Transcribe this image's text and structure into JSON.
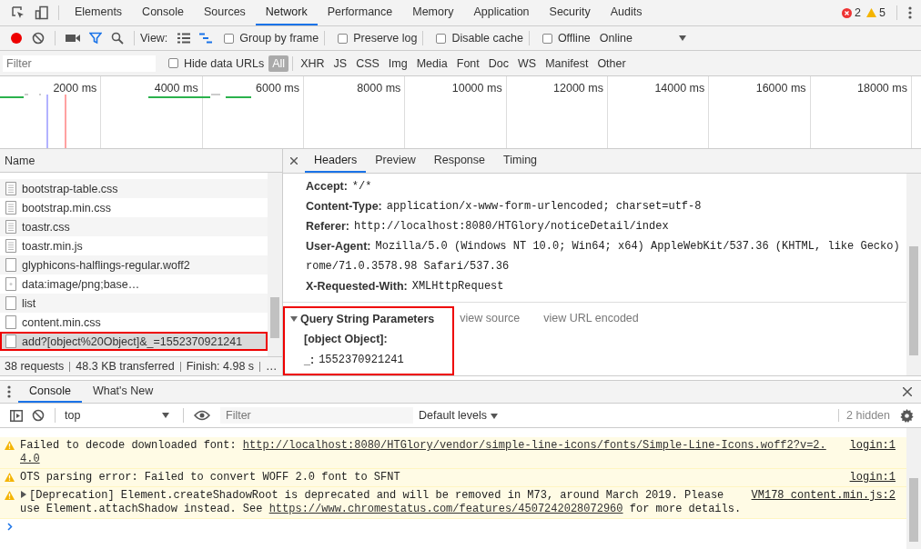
{
  "main_tabs": [
    {
      "label": "Elements",
      "selected": false
    },
    {
      "label": "Console",
      "selected": false
    },
    {
      "label": "Sources",
      "selected": false
    },
    {
      "label": "Network",
      "selected": true
    },
    {
      "label": "Performance",
      "selected": false
    },
    {
      "label": "Memory",
      "selected": false
    },
    {
      "label": "Application",
      "selected": false
    },
    {
      "label": "Security",
      "selected": false
    },
    {
      "label": "Audits",
      "selected": false
    }
  ],
  "issues": {
    "errors": "2",
    "warnings": "5"
  },
  "network_toolbar": {
    "recording": true,
    "view_label": "View:",
    "checkboxes": [
      {
        "label": "Group by frame",
        "checked": false
      },
      {
        "label": "Preserve log",
        "checked": false
      },
      {
        "label": "Disable cache",
        "checked": false
      },
      {
        "label": "Offline",
        "checked": false
      }
    ],
    "throttling": "Online"
  },
  "filter_bar": {
    "placeholder": "Filter",
    "hide_data_urls": {
      "label": "Hide data URLs",
      "checked": false
    },
    "types": [
      {
        "label": "All",
        "selected": true
      },
      {
        "label": "XHR",
        "selected": false
      },
      {
        "label": "JS",
        "selected": false
      },
      {
        "label": "CSS",
        "selected": false
      },
      {
        "label": "Img",
        "selected": false
      },
      {
        "label": "Media",
        "selected": false
      },
      {
        "label": "Font",
        "selected": false
      },
      {
        "label": "Doc",
        "selected": false
      },
      {
        "label": "WS",
        "selected": false
      },
      {
        "label": "Manifest",
        "selected": false
      },
      {
        "label": "Other",
        "selected": false
      }
    ]
  },
  "overview": {
    "ticks": [
      "2000 ms",
      "4000 ms",
      "6000 ms",
      "8000 ms",
      "10000 ms",
      "12000 ms",
      "14000 ms",
      "16000 ms",
      "18000 ms"
    ]
  },
  "requests": {
    "column": "Name",
    "rows": [
      {
        "name": "bootstrap-table.css",
        "kind": "stylesheet",
        "selected": false,
        "annotated": false
      },
      {
        "name": "bootstrap.min.css",
        "kind": "stylesheet",
        "selected": false,
        "annotated": false
      },
      {
        "name": "toastr.css",
        "kind": "stylesheet",
        "selected": false,
        "annotated": false
      },
      {
        "name": "toastr.min.js",
        "kind": "stylesheet",
        "selected": false,
        "annotated": false
      },
      {
        "name": "glyphicons-halflings-regular.woff2",
        "kind": "plain",
        "selected": false,
        "annotated": false
      },
      {
        "name": "data:image/png;base…",
        "kind": "image",
        "selected": false,
        "annotated": false
      },
      {
        "name": "list",
        "kind": "plain",
        "selected": false,
        "annotated": false
      },
      {
        "name": "content.min.css",
        "kind": "plain",
        "selected": false,
        "annotated": false
      },
      {
        "name": "add?[object%20Object]&_=1552370921241",
        "kind": "plain",
        "selected": true,
        "annotated": true
      }
    ],
    "summary": [
      "38 requests",
      "48.3 KB transferred",
      "Finish: 4.98 s",
      "…"
    ]
  },
  "details": {
    "tabs": [
      {
        "label": "Headers",
        "selected": true
      },
      {
        "label": "Preview",
        "selected": false
      },
      {
        "label": "Response",
        "selected": false
      },
      {
        "label": "Timing",
        "selected": false
      }
    ],
    "headers": [
      {
        "name": "Accept:",
        "value_lines": [
          "*/*"
        ]
      },
      {
        "name": "Content-Type:",
        "value_lines": [
          "application/x-www-form-urlencoded; charset=utf-8"
        ]
      },
      {
        "name": "Referer:",
        "value_lines": [
          "http://localhost:8080/HTGlory/noticeDetail/index"
        ]
      },
      {
        "name": "User-Agent:",
        "value_lines": [
          "Mozilla/5.0 (Windows NT 10.0; Win64; x64) AppleWebKit/537.36 (KHTML, like Gecko)",
          "rome/71.0.3578.98 Safari/537.36"
        ]
      },
      {
        "name": "X-Requested-With:",
        "value_lines": [
          "XMLHttpRequest"
        ]
      }
    ],
    "query": {
      "title": "Query String Parameters",
      "expanded": true,
      "annotated": true,
      "links": [
        "view source",
        "view URL encoded"
      ],
      "params": [
        {
          "name": "[object Object]:"
        },
        {
          "name": "_:",
          "value": "1552370921241"
        }
      ]
    }
  },
  "drawer": {
    "tabs": [
      {
        "label": "Console",
        "selected": true
      },
      {
        "label": "What's New",
        "selected": false
      }
    ],
    "context": "top",
    "filter_placeholder": "Filter",
    "levels": "Default levels",
    "hidden": "2 hidden",
    "messages": [
      {
        "kind": "warning",
        "expandable": false,
        "source": "login:1",
        "lines": [
          [
            {
              "text": "Failed to decode downloaded font: "
            },
            {
              "link": "http://localhost:8080/HTGlory/vendor/simple-line-icons/fonts/Simple-Line-Icons.woff2?v=2."
            }
          ],
          [
            {
              "link": "4.0"
            }
          ]
        ]
      },
      {
        "kind": "warning",
        "expandable": false,
        "source": "login:1",
        "lines": [
          [
            {
              "text": "OTS parsing error: Failed to convert WOFF 2.0 font to SFNT"
            }
          ]
        ]
      },
      {
        "kind": "warning",
        "expandable": true,
        "source": "VM178 content.min.js:2",
        "lines": [
          [
            {
              "text": "[Deprecation] Element.createShadowRoot is deprecated and will be removed in M73, around March 2019. Please"
            }
          ],
          [
            {
              "text": "use Element.attachShadow instead. See "
            },
            {
              "link": "https://www.chromestatus.com/features/4507242028072960"
            },
            {
              "text": " for more details."
            }
          ]
        ]
      }
    ]
  }
}
